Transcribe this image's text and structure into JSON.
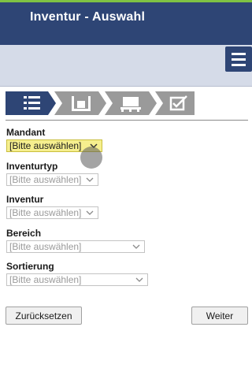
{
  "header": {
    "title": "Inventur - Auswahl"
  },
  "toolbar": {
    "menu_icon": "hamburger-menu-icon"
  },
  "wizard": {
    "steps": [
      {
        "icon": "list-icon",
        "active": true
      },
      {
        "icon": "pallet-rack-icon",
        "active": false
      },
      {
        "icon": "pallet-box-icon",
        "active": false
      },
      {
        "icon": "checklist-edit-icon",
        "active": false
      }
    ],
    "colors": {
      "active": "#2e4575",
      "inactive": "#9a9a9a"
    }
  },
  "form": {
    "mandant": {
      "label": "Mandant",
      "value": "[Bitte auswählen]"
    },
    "inventurtyp": {
      "label": "Inventurtyp",
      "value": "[Bitte auswählen]"
    },
    "inventur": {
      "label": "Inventur",
      "value": "[Bitte auswählen]"
    },
    "bereich": {
      "label": "Bereich",
      "value": "[Bitte auswählen]"
    },
    "sortierung": {
      "label": "Sortierung",
      "value": "[Bitte auswählen]"
    }
  },
  "actions": {
    "reset_label": "Zurücksetzen",
    "next_label": "Weiter"
  }
}
